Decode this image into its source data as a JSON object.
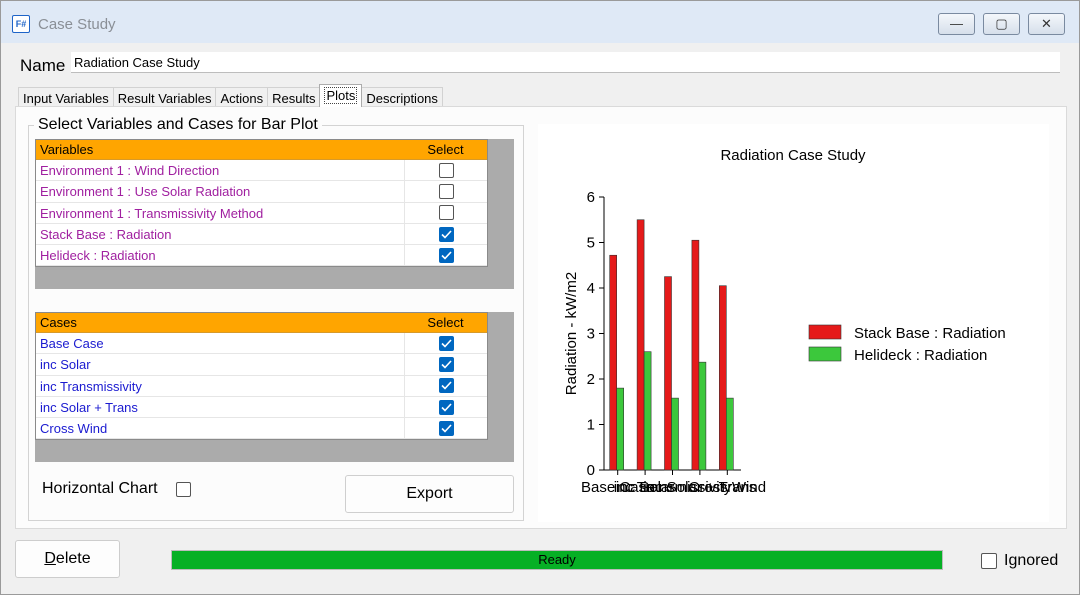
{
  "window": {
    "title": "Case Study",
    "app_icon_text": "F#",
    "controls": {
      "minimize": "—",
      "maximize": "▢",
      "close": "✕"
    }
  },
  "name_field": {
    "label": "Name",
    "value": "Radiation Case Study"
  },
  "tabs": [
    {
      "label": "Input Variables",
      "active": false
    },
    {
      "label": "Result Variables",
      "active": false
    },
    {
      "label": "Actions",
      "active": false
    },
    {
      "label": "Results",
      "active": false
    },
    {
      "label": "Plots",
      "active": true
    },
    {
      "label": "Descriptions",
      "active": false
    }
  ],
  "plot_panel": {
    "group_title": "Select Variables and Cases for Bar Plot",
    "variables_grid": {
      "headers": [
        "Variables",
        "Select"
      ],
      "rows": [
        {
          "label": "Environment 1 : Wind Direction",
          "checked": false
        },
        {
          "label": "Environment 1 : Use Solar Radiation",
          "checked": false
        },
        {
          "label": "Environment 1 : Transmissivity Method",
          "checked": false
        },
        {
          "label": "Stack Base : Radiation",
          "checked": true
        },
        {
          "label": "Helideck : Radiation",
          "checked": true
        }
      ]
    },
    "cases_grid": {
      "headers": [
        "Cases",
        "Select"
      ],
      "rows": [
        {
          "label": "Base Case",
          "checked": true
        },
        {
          "label": "inc Solar",
          "checked": true
        },
        {
          "label": "inc Transmissivity",
          "checked": true
        },
        {
          "label": "inc Solar + Trans",
          "checked": true
        },
        {
          "label": "Cross Wind",
          "checked": true
        }
      ]
    },
    "horizontal_chart_label": "Horizontal Chart",
    "horizontal_chart_checked": false,
    "export_label": "Export"
  },
  "chart_data": {
    "type": "bar",
    "title": "Radiation Case Study",
    "ylabel": "Radiation - kW/m2",
    "xlabel": "",
    "ylim": [
      0,
      6
    ],
    "yticks": [
      0,
      1,
      2,
      3,
      4,
      5,
      6
    ],
    "categories": [
      "Base Case",
      "inc Solar",
      "inc Transmissivity",
      "inc Solar + Trans",
      "Cross Wind"
    ],
    "series": [
      {
        "name": "Stack Base : Radiation",
        "color": "#e51a1a",
        "values": [
          4.72,
          5.5,
          4.25,
          5.05,
          4.05
        ]
      },
      {
        "name": "Helideck : Radiation",
        "color": "#3cc83c",
        "values": [
          1.8,
          2.6,
          1.58,
          2.37,
          1.58
        ]
      }
    ],
    "legend_position": "right",
    "grid": false
  },
  "footer": {
    "delete_label": "Delete",
    "delete_mnemonic": "D",
    "status_text": "Ready",
    "progress_fraction": 1.0,
    "ignored_label": "Ignored",
    "ignored_checked": false
  },
  "colors": {
    "header_orange": "#ffa500",
    "variable_text": "#a020a0",
    "case_text": "#1a1ad0",
    "progress_green": "#06b025",
    "checkbox_blue": "#0067c0"
  }
}
